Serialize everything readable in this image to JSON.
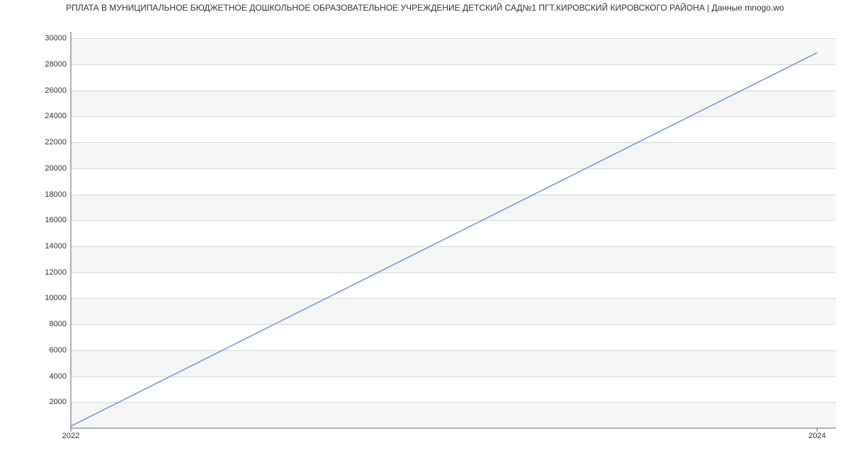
{
  "chart_data": {
    "type": "line",
    "title": "РПЛАТА В МУНИЦИПАЛЬНОЕ БЮДЖЕТНОЕ ДОШКОЛЬНОЕ ОБРАЗОВАТЕЛЬНОЕ УЧРЕЖДЕНИЕ ДЕТСКИЙ САД№1 ПГТ.КИРОВСКИЙ КИРОВСКОГО РАЙОНА | Данные mnogo.wo",
    "xlabel": "",
    "ylabel": "",
    "x": [
      2022,
      2024
    ],
    "values": [
      150,
      28900
    ],
    "x_ticks": [
      2022,
      2024
    ],
    "y_ticks": [
      2000,
      4000,
      6000,
      8000,
      10000,
      12000,
      14000,
      16000,
      18000,
      20000,
      22000,
      24000,
      26000,
      28000,
      30000
    ],
    "xlim": [
      2022,
      2024.05
    ],
    "ylim": [
      0,
      30500
    ],
    "grid": true,
    "series_color": "#6f93d8"
  }
}
